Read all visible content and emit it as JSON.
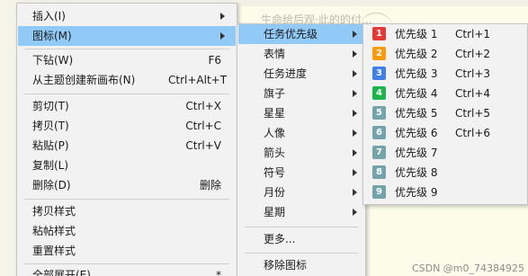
{
  "background": {
    "ghost_text": "生命给后观·此的的付…"
  },
  "watermark": "CSDN @m0_74384925",
  "main_menu": {
    "items": [
      {
        "label": "插入(I)",
        "shortcut": "",
        "submenu": true
      },
      {
        "label": "图标(M)",
        "shortcut": "",
        "submenu": true,
        "highlighted": true
      },
      {
        "label": "下钻(W)",
        "shortcut": "F6"
      },
      {
        "label": "从主题创建新画布(N)",
        "shortcut": "Ctrl+Alt+T"
      },
      {
        "label": "剪切(T)",
        "shortcut": "Ctrl+X"
      },
      {
        "label": "拷贝(T)",
        "shortcut": "Ctrl+C"
      },
      {
        "label": "粘贴(P)",
        "shortcut": "Ctrl+V"
      },
      {
        "label": "复制(L)",
        "shortcut": ""
      },
      {
        "label": "删除(D)",
        "shortcut": "删除"
      },
      {
        "label": "拷贝样式",
        "shortcut": ""
      },
      {
        "label": "粘帖样式",
        "shortcut": ""
      },
      {
        "label": "重置样式",
        "shortcut": ""
      },
      {
        "label": "全部展开(E)",
        "shortcut": "*"
      }
    ]
  },
  "icon_submenu": {
    "items": [
      {
        "label": "任务优先级",
        "submenu": true,
        "highlighted": true
      },
      {
        "label": "表情",
        "submenu": true
      },
      {
        "label": "任务进度",
        "submenu": true
      },
      {
        "label": "旗子",
        "submenu": true
      },
      {
        "label": "星星",
        "submenu": true
      },
      {
        "label": "人像",
        "submenu": true
      },
      {
        "label": "箭头",
        "submenu": true
      },
      {
        "label": "符号",
        "submenu": true
      },
      {
        "label": "月份",
        "submenu": true
      },
      {
        "label": "星期",
        "submenu": true
      },
      {
        "label": "更多...",
        "submenu": false
      },
      {
        "label": "移除图标",
        "submenu": false
      }
    ]
  },
  "priority_submenu": {
    "items": [
      {
        "number": "1",
        "label": "优先级 1",
        "shortcut": "Ctrl+1",
        "color": "#e53935"
      },
      {
        "number": "2",
        "label": "优先级 2",
        "shortcut": "Ctrl+2",
        "color": "#fb9b0a"
      },
      {
        "number": "3",
        "label": "优先级 3",
        "shortcut": "Ctrl+3",
        "color": "#3f7fe6"
      },
      {
        "number": "4",
        "label": "优先级 4",
        "shortcut": "Ctrl+4",
        "color": "#1db34d"
      },
      {
        "number": "5",
        "label": "优先级 5",
        "shortcut": "Ctrl+5",
        "color": "#74a4aa"
      },
      {
        "number": "6",
        "label": "优先级 6",
        "shortcut": "Ctrl+6",
        "color": "#74a4aa"
      },
      {
        "number": "7",
        "label": "优先级 7",
        "shortcut": "",
        "color": "#74a4aa"
      },
      {
        "number": "8",
        "label": "优先级 8",
        "shortcut": "",
        "color": "#74a4aa"
      },
      {
        "number": "9",
        "label": "优先级 9",
        "shortcut": "",
        "color": "#74a4aa"
      }
    ]
  }
}
